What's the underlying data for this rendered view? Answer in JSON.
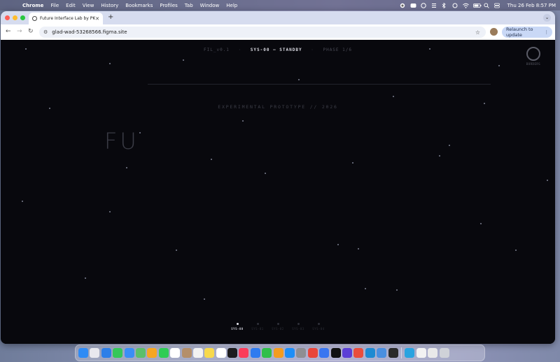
{
  "menubar": {
    "app_name": "Chrome",
    "items": [
      "File",
      "Edit",
      "View",
      "History",
      "Bookmarks",
      "Profiles",
      "Tab",
      "Window",
      "Help"
    ],
    "clock": "Thu 26 Feb  8:57 PM"
  },
  "browser": {
    "tab_title": "Future Interface Lab by PK - …",
    "url": "glad-wad-53268566.figma.site",
    "relaunch_label": "Relaunch to update"
  },
  "page": {
    "hud": {
      "left": "FIL_v0.1",
      "center": "SYS-00 — STANDBY",
      "right": "PHASE 1/6"
    },
    "subtitle": "EXPERIMENTAL PROTOTYPE // 2026",
    "headline": "FU",
    "logo_text": "BORDERS",
    "steps": [
      {
        "label": "SYS-00",
        "active": true
      },
      {
        "label": "SYS-01",
        "active": false
      },
      {
        "label": "SYS-02",
        "active": false
      },
      {
        "label": "SYS-03",
        "active": false
      },
      {
        "label": "SYS-04",
        "active": false
      }
    ]
  },
  "dock": {
    "icons": [
      {
        "name": "finder-icon",
        "color": "#2f8bf5"
      },
      {
        "name": "launchpad-icon",
        "color": "#e8e8ee"
      },
      {
        "name": "safari-icon",
        "color": "#2d7fe8"
      },
      {
        "name": "messages-icon",
        "color": "#34c759"
      },
      {
        "name": "mail-icon",
        "color": "#3a8ef6"
      },
      {
        "name": "maps-icon",
        "color": "#5bbf6b"
      },
      {
        "name": "photos-icon",
        "color": "#f5a623"
      },
      {
        "name": "facetime-icon",
        "color": "#2ecc55"
      },
      {
        "name": "calendar-icon",
        "color": "#ffffff"
      },
      {
        "name": "contacts-icon",
        "color": "#b48f6a"
      },
      {
        "name": "reminders-icon",
        "color": "#f2f2f2"
      },
      {
        "name": "notes-icon",
        "color": "#f7d94c"
      },
      {
        "name": "freeform-icon",
        "color": "#ffffff"
      },
      {
        "name": "tv-icon",
        "color": "#1c1c1e"
      },
      {
        "name": "music-icon",
        "color": "#fa3c5a"
      },
      {
        "name": "keynote-icon",
        "color": "#2e7bf0"
      },
      {
        "name": "numbers-icon",
        "color": "#2fbf4a"
      },
      {
        "name": "pages-icon",
        "color": "#f39c1f"
      },
      {
        "name": "app-store-icon",
        "color": "#1e8ef7"
      },
      {
        "name": "system-settings-icon",
        "color": "#8e8e93"
      },
      {
        "name": "chrome-icon",
        "color": "#e9463b"
      },
      {
        "name": "signal-icon",
        "color": "#3a76f0"
      },
      {
        "name": "chatgpt-icon",
        "color": "#111111"
      },
      {
        "name": "perplexity-icon",
        "color": "#5b3fd6"
      },
      {
        "name": "figma-icon",
        "color": "#e94d3c"
      },
      {
        "name": "vscode-icon",
        "color": "#1f8ad2"
      },
      {
        "name": "preview-icon",
        "color": "#4a8fe0"
      },
      {
        "name": "figma-app-icon",
        "color": "#2a2a2a"
      },
      {
        "name": "telegram-icon",
        "color": "#2aa3e0"
      },
      {
        "name": "document-icon",
        "color": "#f2f2f2"
      },
      {
        "name": "folder-icon",
        "color": "#e9e9e9"
      },
      {
        "name": "trash-icon",
        "color": "#cfd2d8"
      }
    ]
  }
}
